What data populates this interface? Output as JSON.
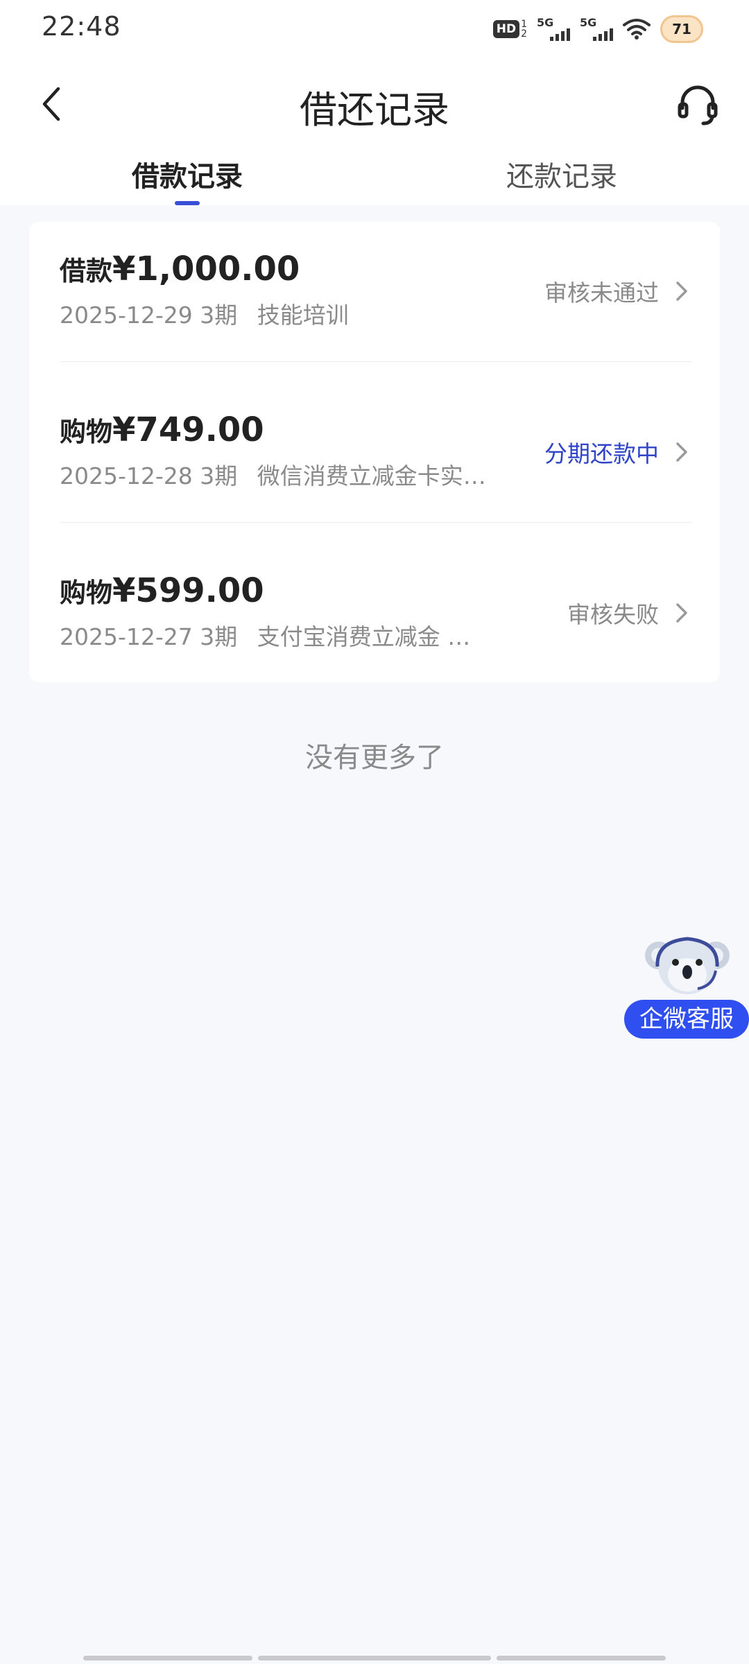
{
  "status_bar": {
    "time": "22:48",
    "hd_label": "HD",
    "hd_sub_top": "1",
    "hd_sub_bottom": "2",
    "sim1_label": "5G",
    "sim2_label": "5G",
    "battery": "71"
  },
  "header": {
    "title": "借还记录",
    "back_icon": "chevron-left-icon",
    "support_icon": "headset-icon"
  },
  "tabs": [
    {
      "label": "借款记录",
      "active": true
    },
    {
      "label": "还款记录",
      "active": false
    }
  ],
  "records": [
    {
      "type": "借款",
      "amount": "¥1,000.00",
      "date": "2025-12-29",
      "period": "3期",
      "desc": "技能培训",
      "status": "审核未通过",
      "status_active": false
    },
    {
      "type": "购物",
      "amount": "¥749.00",
      "date": "2025-12-28",
      "period": "3期",
      "desc": "微信消费立减金卡实…",
      "status": "分期还款中",
      "status_active": true
    },
    {
      "type": "购物",
      "amount": "¥599.00",
      "date": "2025-12-27",
      "period": "3期",
      "desc": "支付宝消费立减金 …",
      "status": "审核失败",
      "status_active": false
    }
  ],
  "footer_text": "没有更多了",
  "floating_service": {
    "label": "企微客服",
    "icon": "koala-mascot-icon"
  },
  "colors": {
    "accent": "#2f44c9",
    "float_button": "#2f4ff0",
    "background": "#f7f8fc"
  }
}
